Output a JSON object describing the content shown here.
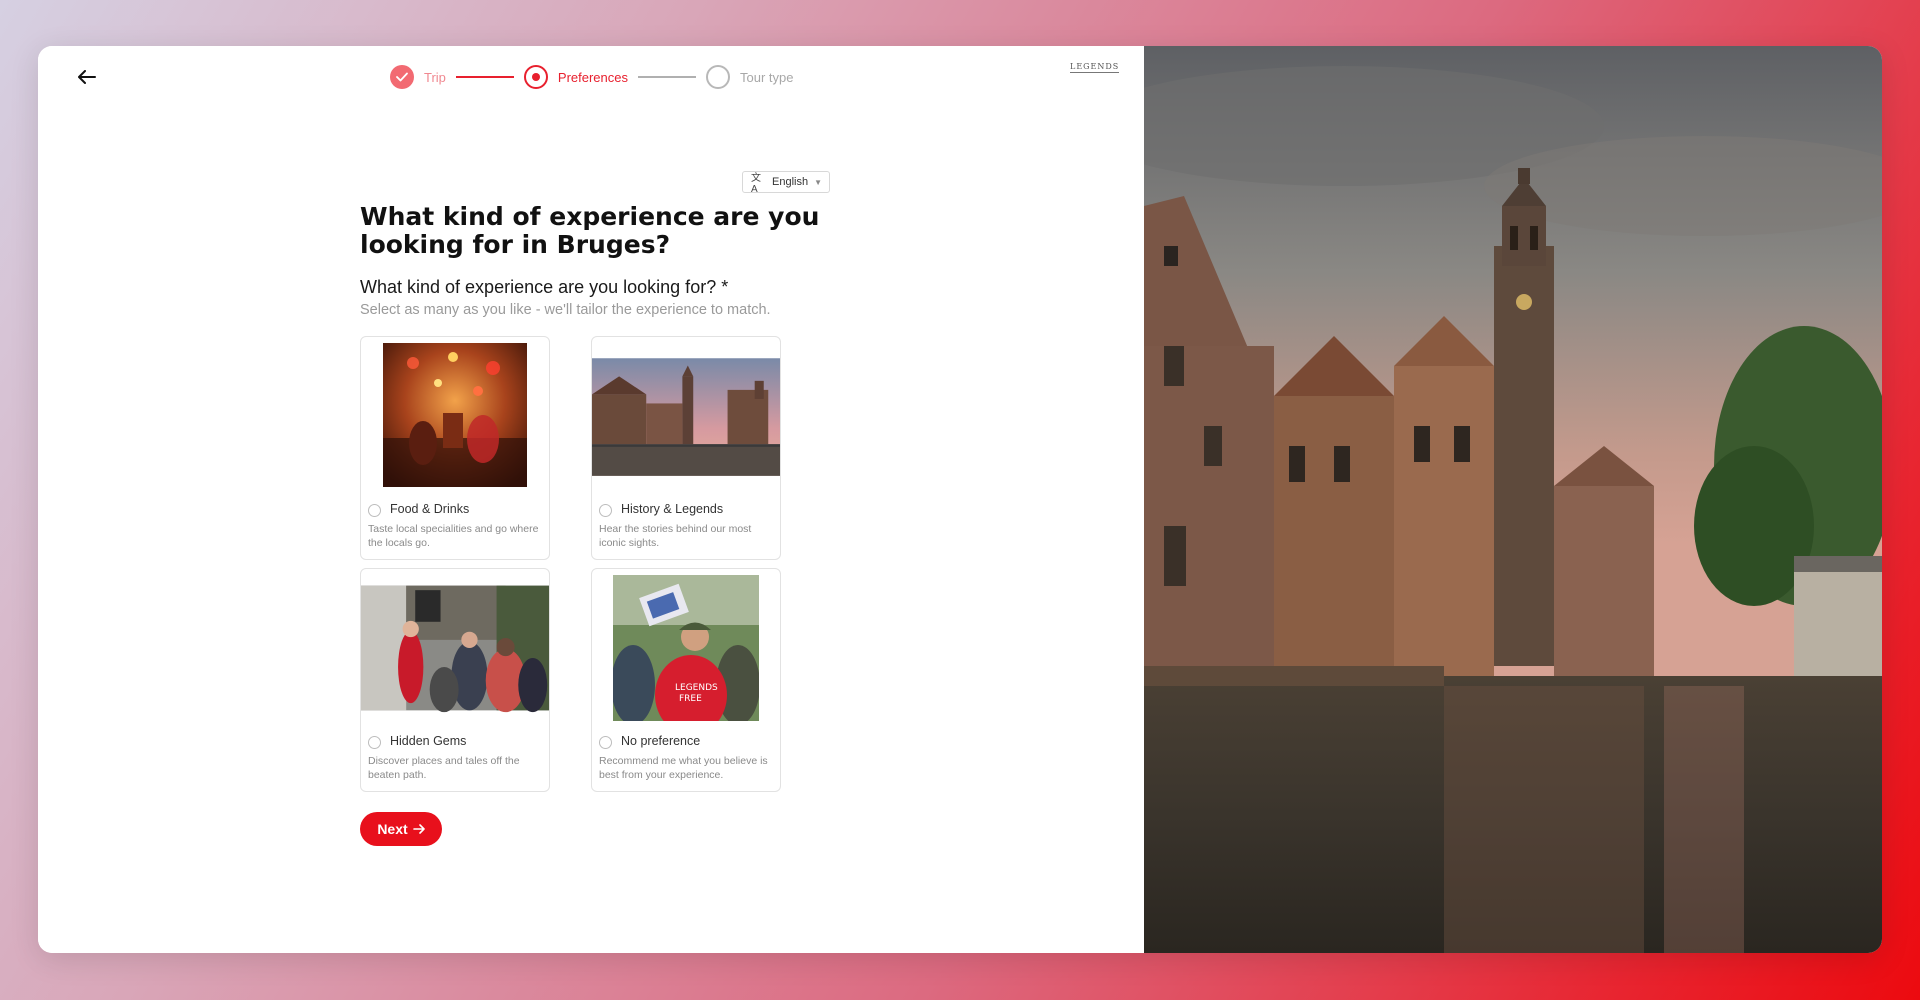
{
  "header": {
    "steps": [
      {
        "label": "Trip",
        "state": "done"
      },
      {
        "label": "Preferences",
        "state": "active"
      },
      {
        "label": "Tour type",
        "state": "todo"
      }
    ],
    "logo_text": "LEGENDS"
  },
  "language": {
    "selected": "English"
  },
  "form": {
    "title": "What kind of experience are you looking for in Bruges?",
    "question": "What kind of experience are you looking for? *",
    "helper": "Select as many as you like - we'll tailor the experience to match.",
    "options": [
      {
        "label": "Food & Drinks",
        "description": "Taste local specialities and go where the locals go."
      },
      {
        "label": "History & Legends",
        "description": "Hear the stories behind our most iconic sights."
      },
      {
        "label": "Hidden Gems",
        "description": "Discover places and tales off the beaten path."
      },
      {
        "label": "No preference",
        "description": "Recommend me what you believe is best from your experience."
      }
    ],
    "next_label": "Next"
  },
  "colors": {
    "accent": "#e8101c",
    "accent_light": "#f26a72"
  }
}
